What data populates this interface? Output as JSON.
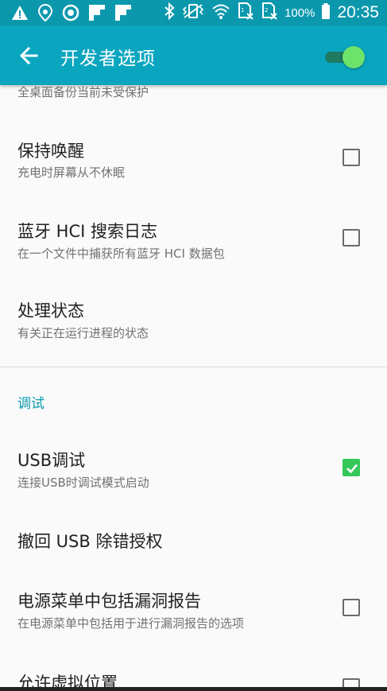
{
  "status_bar": {
    "battery": "100%",
    "time": "20:35",
    "background": "#0b98ad"
  },
  "app_bar": {
    "title": "开发者选项",
    "master_switch_on": true,
    "background": "#0aa6c0"
  },
  "settings": [
    {
      "subtitle": "全桌面备份当前未受保护"
    },
    {
      "title": "保持唤醒",
      "subtitle": "充电时屏幕从不休眠",
      "checked": false
    },
    {
      "title": "蓝牙 HCI 搜索日志",
      "subtitle": "在一个文件中捕获所有蓝牙 HCI 数据包",
      "checked": false
    },
    {
      "title": "处理状态",
      "subtitle": "有关正在运行进程的状态"
    }
  ],
  "debug_section": {
    "header": "调试",
    "items": [
      {
        "title": "USB调试",
        "subtitle": "连接USB时调试模式启动",
        "checked": true
      },
      {
        "title": "撤回 USB 除错授权"
      },
      {
        "title": "电源菜单中包括漏洞报告",
        "subtitle": "在电源菜单中包括用于进行漏洞报告的选项",
        "checked": false
      },
      {
        "title": "允许虚拟位置",
        "checked": false
      }
    ]
  },
  "colors": {
    "accent": "#0a9bb0",
    "checkbox_checked": "#34c759",
    "switch_thumb": "#6ee36a"
  }
}
